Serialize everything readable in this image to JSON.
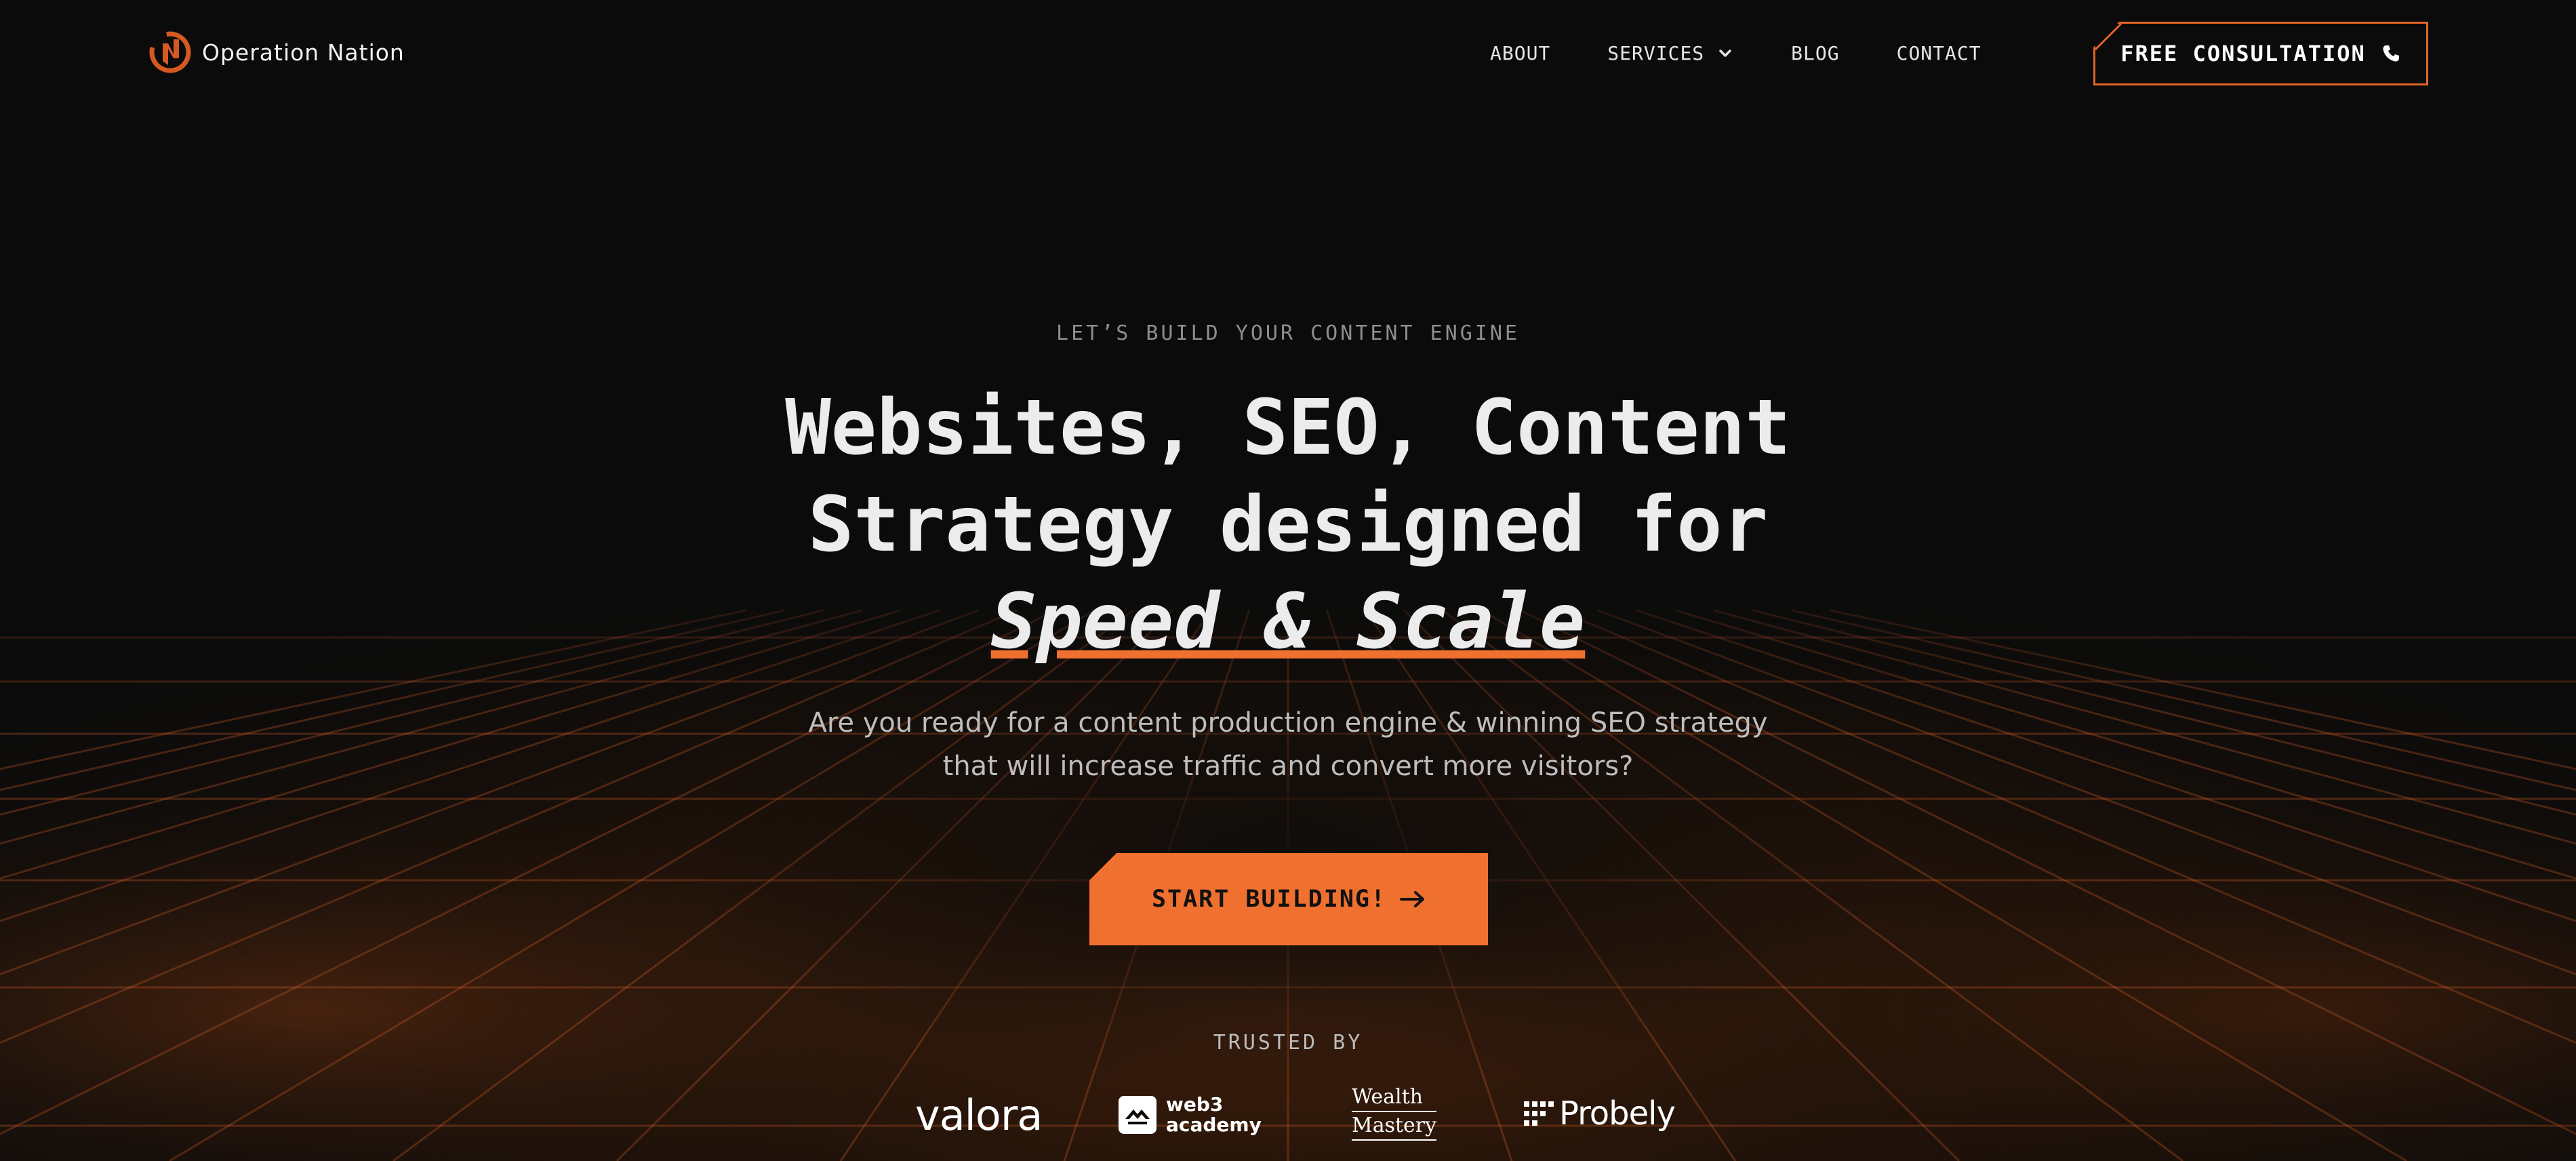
{
  "brand": {
    "name": "Operation Nation"
  },
  "nav": {
    "links": [
      "ABOUT",
      "SERVICES",
      "BLOG",
      "CONTACT"
    ],
    "cta_label": "FREE CONSULTATION"
  },
  "hero": {
    "eyebrow": "LET’S BUILD YOUR CONTENT ENGINE",
    "headline_line1": "Websites, SEO, Content",
    "headline_line2": "Strategy designed for",
    "headline_highlight": "Speed & Scale",
    "subtext": "Are you ready for a content production engine & winning SEO strategy that will increase traffic and convert more visitors?",
    "cta_label": "START BUILDING!"
  },
  "trusted": {
    "label": "TRUSTED BY",
    "logos": {
      "valora": "valora",
      "web3_line1": "web3",
      "web3_line2": "academy",
      "wealth_line1": "Wealth",
      "wealth_line2": "Mastery",
      "probely": "Probely"
    }
  },
  "colors": {
    "accent": "#f07030",
    "background": "#0b0b0b",
    "text": "#ececec",
    "muted": "#8e8e8e"
  },
  "icons": [
    "logo-bolt-icon",
    "chevron-down-icon",
    "phone-icon",
    "arrow-right-icon",
    "web3-diamond-icon",
    "probely-dots-icon"
  ]
}
